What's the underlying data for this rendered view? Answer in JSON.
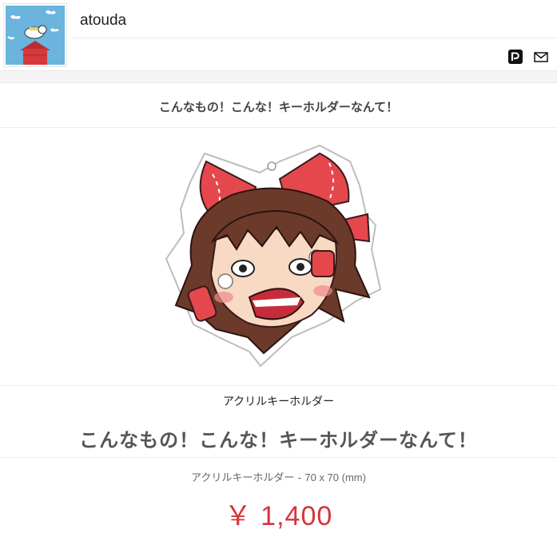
{
  "shop": {
    "name": "atouda"
  },
  "header": {
    "icons": [
      "pixiv-icon",
      "mail-icon"
    ]
  },
  "product": {
    "title": "こんなもの！こんな！キーホルダーなんて！",
    "category": "アクリルキーホルダー",
    "spec_name": "アクリルキーホルダー",
    "spec_separator": " - ",
    "spec_size": "70 x 70 (mm)",
    "price": "￥ 1,400"
  },
  "colors": {
    "price": "#d4343b",
    "avatar_sky": "#6ab4dd",
    "avatar_roof": "#d6383e",
    "bow_red": "#e5484c",
    "hair_brown": "#6b3a2b"
  }
}
